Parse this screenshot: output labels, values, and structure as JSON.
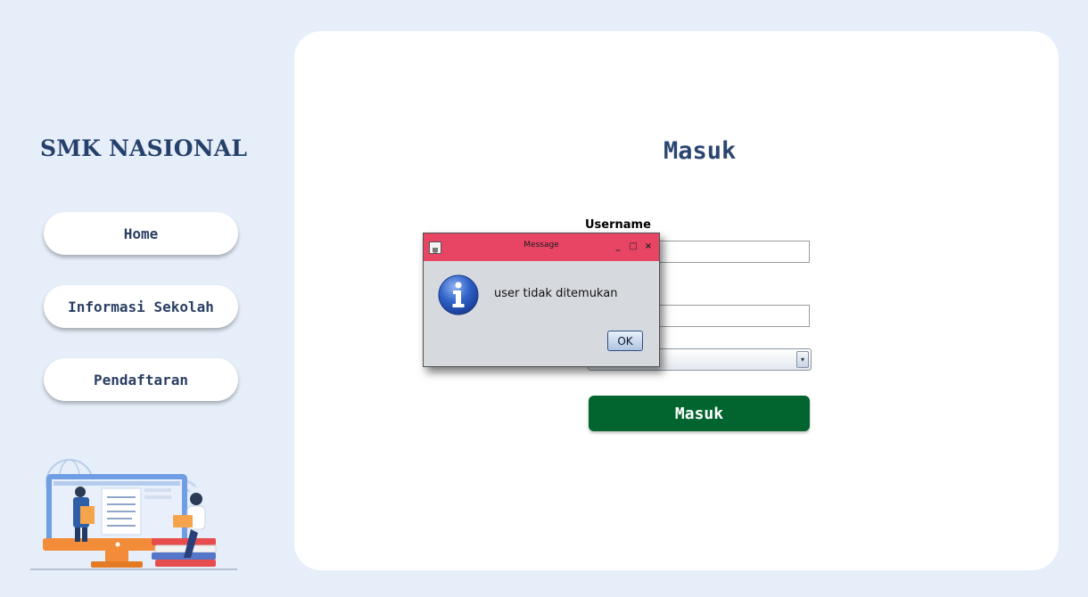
{
  "sidebar": {
    "brand": "SMK NASIONAL",
    "nav": [
      {
        "label": "Home"
      },
      {
        "label": "Informasi Sekolah"
      },
      {
        "label": "Pendaftaran"
      }
    ]
  },
  "form": {
    "title": "Masuk",
    "username_label": "Username",
    "username_value": "",
    "password_value": "",
    "role_value": "",
    "submit_label": "Masuk"
  },
  "dialog": {
    "title": "Message",
    "message": "user tidak ditemukan",
    "ok_label": "OK",
    "minimize": "_",
    "maximize": "□",
    "close": "×"
  },
  "colors": {
    "background": "#e6eef9",
    "brand": "#25406b",
    "submit": "#02652f",
    "dialog_titlebar": "#e84565"
  },
  "icons": {
    "dialog_icon": "info-icon",
    "combo_arrow": "▾"
  }
}
